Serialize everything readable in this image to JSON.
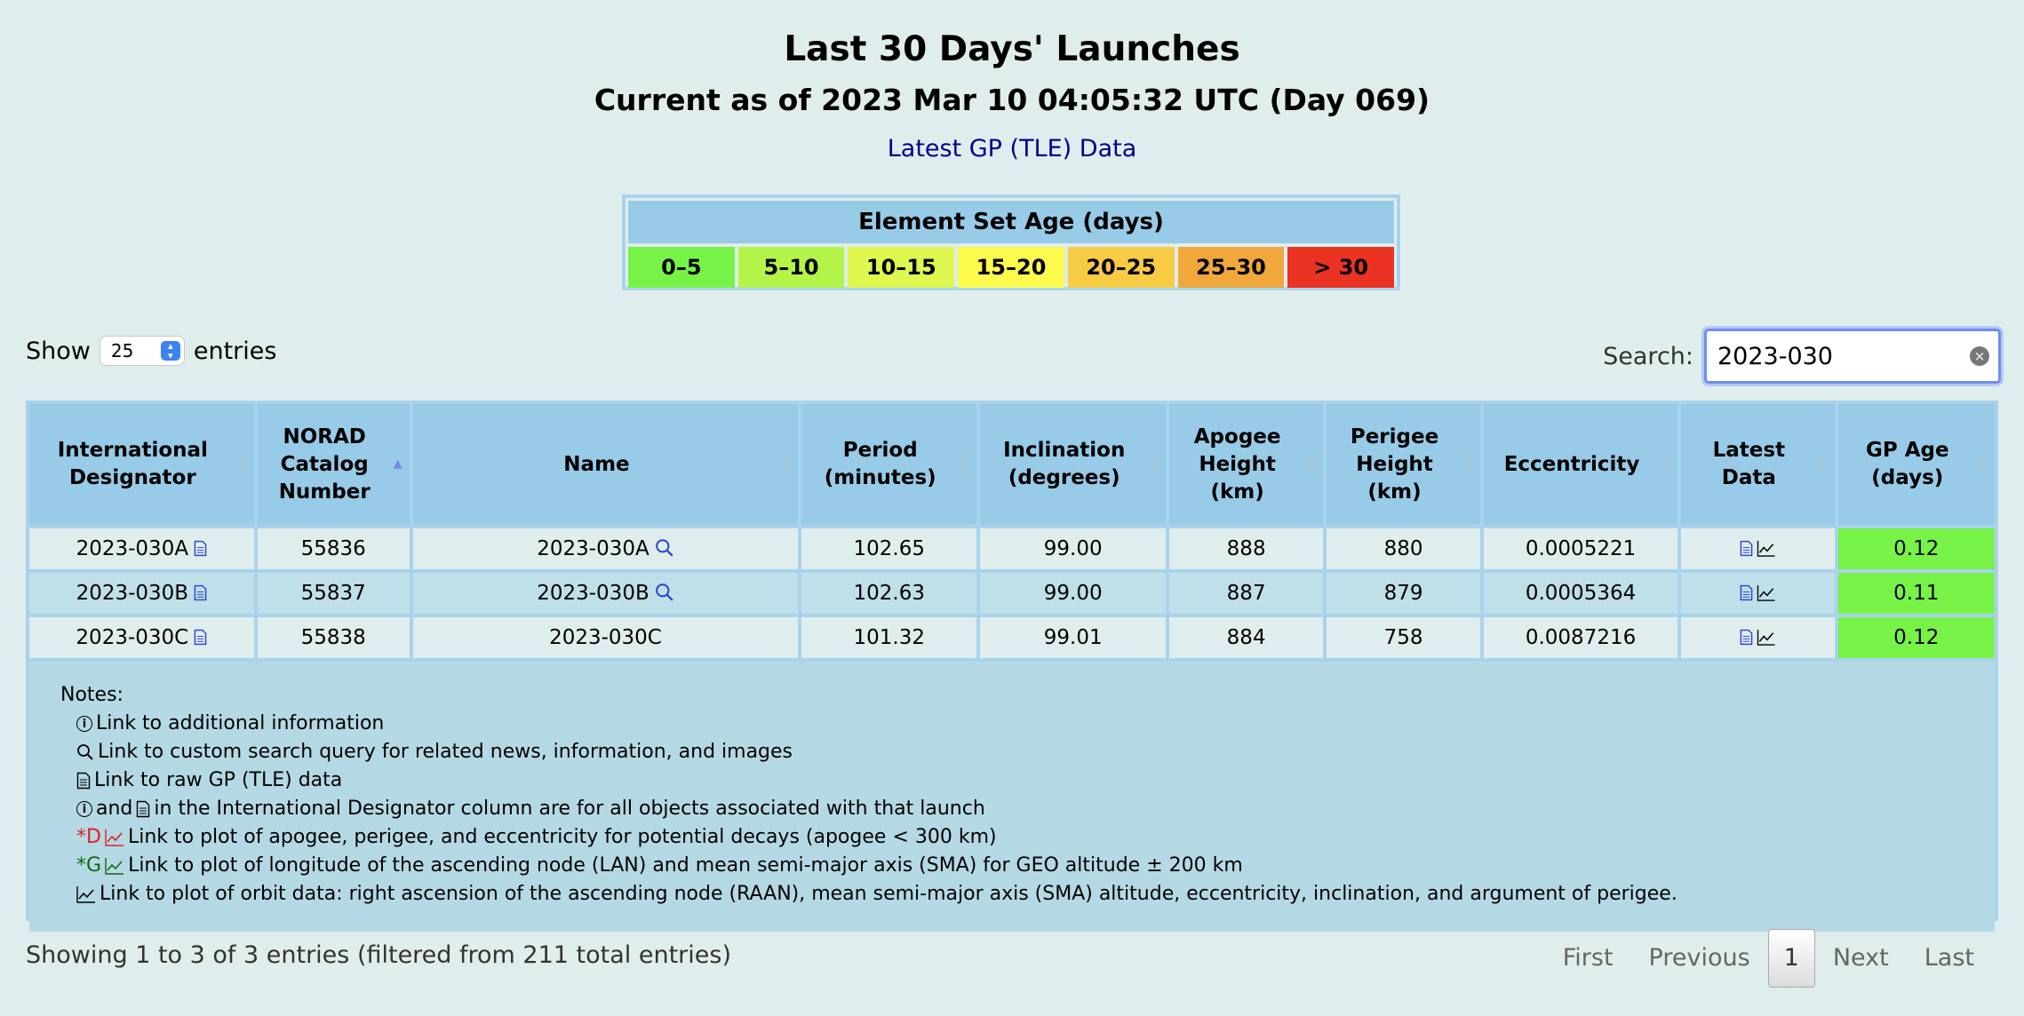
{
  "header": {
    "title": "Last 30 Days' Launches",
    "subtitle": "Current as of 2023 Mar 10 04:05:32 UTC (Day 069)",
    "gp_link": "Latest GP (TLE) Data"
  },
  "legend": {
    "title": "Element Set Age (days)",
    "cells": [
      {
        "label": "0–5",
        "color": "#77f347"
      },
      {
        "label": "5–10",
        "color": "#b3f448"
      },
      {
        "label": "10–15",
        "color": "#dff74e"
      },
      {
        "label": "15–20",
        "color": "#fcfb4e"
      },
      {
        "label": "20–25",
        "color": "#f7cb44"
      },
      {
        "label": "25–30",
        "color": "#f0a73c"
      },
      {
        "label": "> 30",
        "color": "#eb3323"
      }
    ]
  },
  "controls": {
    "show_label": "Show",
    "entries_value": "25",
    "entries_label": "entries",
    "search_label": "Search:",
    "search_value": "2023-030"
  },
  "table": {
    "headers": [
      "International Designator",
      "NORAD Catalog Number",
      "Name",
      "Period (minutes)",
      "Inclination (degrees)",
      "Apogee Height (km)",
      "Perigee Height (km)",
      "Eccentricity",
      "Latest Data",
      "GP Age (days)"
    ],
    "rows": [
      {
        "intl": "2023-030A",
        "norad": "55836",
        "name": "2023-030A",
        "period": "102.65",
        "incl": "99.00",
        "apogee": "888",
        "perigee": "880",
        "ecc": "0.0005221",
        "age": "0.12",
        "has_search": true
      },
      {
        "intl": "2023-030B",
        "norad": "55837",
        "name": "2023-030B",
        "period": "102.63",
        "incl": "99.00",
        "apogee": "887",
        "perigee": "879",
        "ecc": "0.0005364",
        "age": "0.11",
        "has_search": true
      },
      {
        "intl": "2023-030C",
        "norad": "55838",
        "name": "2023-030C",
        "period": "101.32",
        "incl": "99.01",
        "apogee": "884",
        "perigee": "758",
        "ecc": "0.0087216",
        "age": "0.12",
        "has_search": false
      }
    ]
  },
  "notes": {
    "title": "Notes:",
    "info": "Link to additional information",
    "search": "Link to custom search query for related news, information, and images",
    "raw": "Link to raw GP (TLE) data",
    "and_text": "and",
    "intl_text": "in the International Designator column are for all objects associated with that launch",
    "decay_prefix": "*D",
    "decay": "Link to plot of apogee, perigee, and eccentricity for potential decays (apogee < 300 km)",
    "geo_prefix": "*G",
    "geo": "Link to plot of longitude of the ascending node (LAN) and mean semi-major axis (SMA) for GEO altitude ± 200 km",
    "orbit": "Link to plot of orbit data: right ascension of the ascending node (RAAN), mean semi-major axis (SMA) altitude, eccentricity, inclination, and argument of perigee."
  },
  "footer": {
    "info": "Showing 1 to 3 of 3 entries (filtered from 211 total entries)",
    "first": "First",
    "previous": "Previous",
    "current": "1",
    "next": "Next",
    "last": "Last"
  }
}
